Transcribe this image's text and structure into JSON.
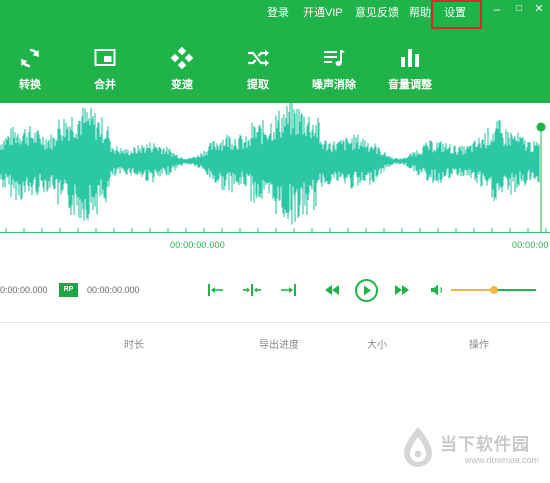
{
  "topmenu": {
    "login": "登录",
    "vip": "开通VIP",
    "feedback": "意见反馈",
    "help": "帮助",
    "settings": "设置"
  },
  "window_buttons": {
    "minimize": "–",
    "maximize": "□",
    "close": "✕"
  },
  "tools": [
    {
      "label": "转换",
      "icon": "refresh-icon"
    },
    {
      "label": "合并",
      "icon": "merge-window-icon"
    },
    {
      "label": "变速",
      "icon": "speed-gamepad-icon"
    },
    {
      "label": "提取",
      "icon": "shuffle-icon"
    },
    {
      "label": "噪声消除",
      "icon": "music-list-icon"
    },
    {
      "label": "音量调整",
      "icon": "bar-chart-icon"
    }
  ],
  "timeline": {
    "center_time": "00:00:00.000",
    "right_time": "00:00:00"
  },
  "controls": {
    "start_time": "0:00:00.000",
    "rp_label": "RP",
    "end_time": "00:00:00.000",
    "volume_level": 0.5
  },
  "table_headers": {
    "duration": "时长",
    "progress": "导出进度",
    "size": "大小",
    "actions": "操作"
  },
  "watermark": {
    "text": "当下软件园",
    "url": "www.downxia.com"
  },
  "colors": {
    "brand_green": "#1fb34a",
    "waveform": "#2cc7a4",
    "highlight_box": "#e0242b",
    "volume_fill": "#f1b744"
  }
}
